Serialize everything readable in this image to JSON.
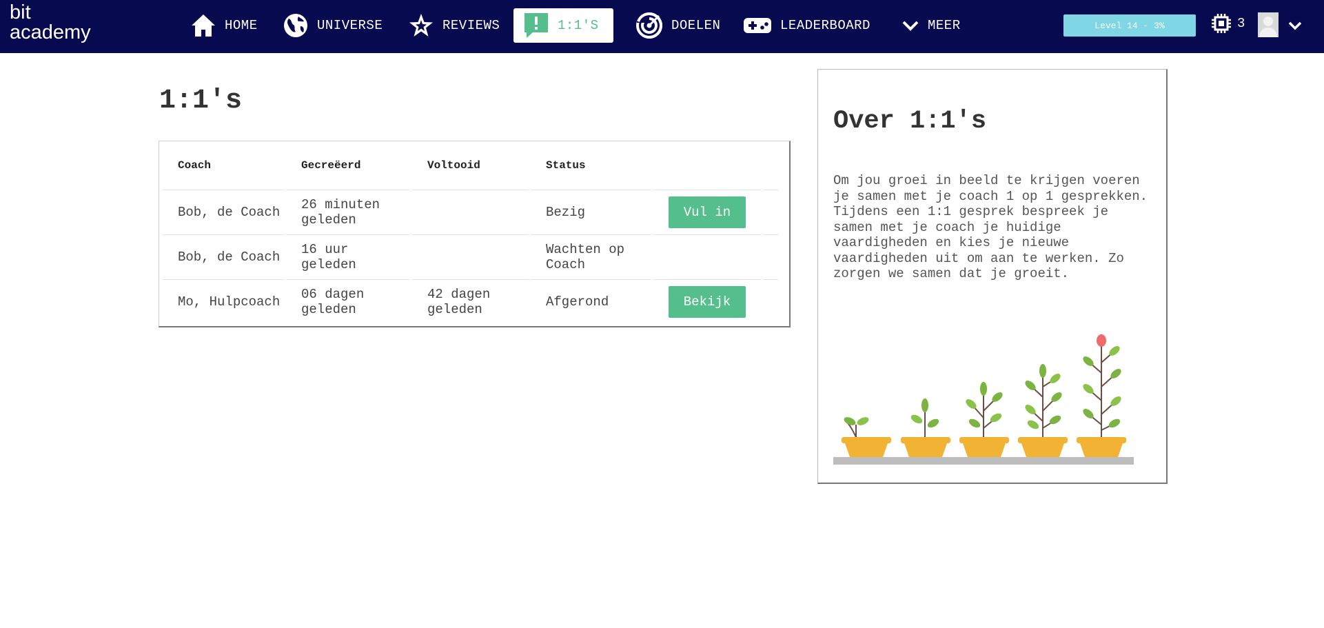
{
  "brand": {
    "line1": "bit",
    "line2": "academy"
  },
  "nav": {
    "items": [
      {
        "label": "HOME",
        "icon": "home-icon"
      },
      {
        "label": "UNIVERSE",
        "icon": "globe-icon"
      },
      {
        "label": "REVIEWS",
        "icon": "star-icon"
      },
      {
        "label": "1:1'S",
        "icon": "chat-icon",
        "active": true
      },
      {
        "label": "DOELEN",
        "icon": "target-icon"
      },
      {
        "label": "LEADERBOARD",
        "icon": "gamepad-icon"
      },
      {
        "label": "MEER",
        "icon": "chevron-down-icon"
      }
    ],
    "level": "Level 14 - 3%",
    "level_progress_pct": 3,
    "chips": "3"
  },
  "page": {
    "title": "1:1's"
  },
  "table": {
    "headers": [
      "Coach",
      "Gecreëerd",
      "Voltooid",
      "Status",
      ""
    ],
    "rows": [
      {
        "coach": "Bob, de Coach",
        "created": "26 minuten geleden",
        "completed": "",
        "status": "Bezig",
        "action": "Vul in"
      },
      {
        "coach": "Bob, de Coach",
        "created": "16 uur geleden",
        "completed": "",
        "status": "Wachten op Coach",
        "action": ""
      },
      {
        "coach": "Mo, Hulpcoach",
        "created": "06 dagen geleden",
        "completed": "42 dagen geleden",
        "status": "Afgerond",
        "action": "Bekijk"
      }
    ]
  },
  "info": {
    "title": "Over 1:1's",
    "text": "Om jou groei in beeld te krijgen voeren je samen met je coach 1 op 1 gesprekken. Tijdens een 1:1 gesprek bespreek je samen met je coach je huidige vaardigheden en kies je nieuwe vaardigheden uit om aan te werken. Zo zorgen we samen dat je groeit."
  },
  "colors": {
    "navbar": "#080a4f",
    "accent": "#54be8c",
    "level_bar": "#7fd6e4",
    "pot": "#f2b233"
  }
}
